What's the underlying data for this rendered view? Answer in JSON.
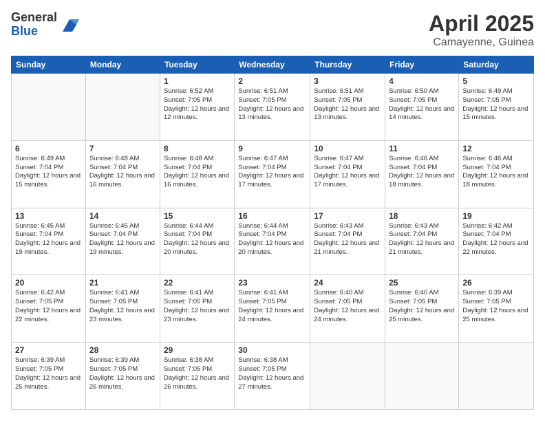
{
  "logo": {
    "general": "General",
    "blue": "Blue"
  },
  "title": {
    "month": "April 2025",
    "location": "Camayenne, Guinea"
  },
  "weekdays": [
    "Sunday",
    "Monday",
    "Tuesday",
    "Wednesday",
    "Thursday",
    "Friday",
    "Saturday"
  ],
  "weeks": [
    [
      {
        "day": "",
        "info": ""
      },
      {
        "day": "",
        "info": ""
      },
      {
        "day": "1",
        "info": "Sunrise: 6:52 AM\nSunset: 7:05 PM\nDaylight: 12 hours and 12 minutes."
      },
      {
        "day": "2",
        "info": "Sunrise: 6:51 AM\nSunset: 7:05 PM\nDaylight: 12 hours and 13 minutes."
      },
      {
        "day": "3",
        "info": "Sunrise: 6:51 AM\nSunset: 7:05 PM\nDaylight: 12 hours and 13 minutes."
      },
      {
        "day": "4",
        "info": "Sunrise: 6:50 AM\nSunset: 7:05 PM\nDaylight: 12 hours and 14 minutes."
      },
      {
        "day": "5",
        "info": "Sunrise: 6:49 AM\nSunset: 7:05 PM\nDaylight: 12 hours and 15 minutes."
      }
    ],
    [
      {
        "day": "6",
        "info": "Sunrise: 6:49 AM\nSunset: 7:04 PM\nDaylight: 12 hours and 15 minutes."
      },
      {
        "day": "7",
        "info": "Sunrise: 6:48 AM\nSunset: 7:04 PM\nDaylight: 12 hours and 16 minutes."
      },
      {
        "day": "8",
        "info": "Sunrise: 6:48 AM\nSunset: 7:04 PM\nDaylight: 12 hours and 16 minutes."
      },
      {
        "day": "9",
        "info": "Sunrise: 6:47 AM\nSunset: 7:04 PM\nDaylight: 12 hours and 17 minutes."
      },
      {
        "day": "10",
        "info": "Sunrise: 6:47 AM\nSunset: 7:04 PM\nDaylight: 12 hours and 17 minutes."
      },
      {
        "day": "11",
        "info": "Sunrise: 6:46 AM\nSunset: 7:04 PM\nDaylight: 12 hours and 18 minutes."
      },
      {
        "day": "12",
        "info": "Sunrise: 6:46 AM\nSunset: 7:04 PM\nDaylight: 12 hours and 18 minutes."
      }
    ],
    [
      {
        "day": "13",
        "info": "Sunrise: 6:45 AM\nSunset: 7:04 PM\nDaylight: 12 hours and 19 minutes."
      },
      {
        "day": "14",
        "info": "Sunrise: 6:45 AM\nSunset: 7:04 PM\nDaylight: 12 hours and 19 minutes."
      },
      {
        "day": "15",
        "info": "Sunrise: 6:44 AM\nSunset: 7:04 PM\nDaylight: 12 hours and 20 minutes."
      },
      {
        "day": "16",
        "info": "Sunrise: 6:44 AM\nSunset: 7:04 PM\nDaylight: 12 hours and 20 minutes."
      },
      {
        "day": "17",
        "info": "Sunrise: 6:43 AM\nSunset: 7:04 PM\nDaylight: 12 hours and 21 minutes."
      },
      {
        "day": "18",
        "info": "Sunrise: 6:43 AM\nSunset: 7:04 PM\nDaylight: 12 hours and 21 minutes."
      },
      {
        "day": "19",
        "info": "Sunrise: 6:42 AM\nSunset: 7:04 PM\nDaylight: 12 hours and 22 minutes."
      }
    ],
    [
      {
        "day": "20",
        "info": "Sunrise: 6:42 AM\nSunset: 7:05 PM\nDaylight: 12 hours and 22 minutes."
      },
      {
        "day": "21",
        "info": "Sunrise: 6:41 AM\nSunset: 7:05 PM\nDaylight: 12 hours and 23 minutes."
      },
      {
        "day": "22",
        "info": "Sunrise: 6:41 AM\nSunset: 7:05 PM\nDaylight: 12 hours and 23 minutes."
      },
      {
        "day": "23",
        "info": "Sunrise: 6:41 AM\nSunset: 7:05 PM\nDaylight: 12 hours and 24 minutes."
      },
      {
        "day": "24",
        "info": "Sunrise: 6:40 AM\nSunset: 7:05 PM\nDaylight: 12 hours and 24 minutes."
      },
      {
        "day": "25",
        "info": "Sunrise: 6:40 AM\nSunset: 7:05 PM\nDaylight: 12 hours and 25 minutes."
      },
      {
        "day": "26",
        "info": "Sunrise: 6:39 AM\nSunset: 7:05 PM\nDaylight: 12 hours and 25 minutes."
      }
    ],
    [
      {
        "day": "27",
        "info": "Sunrise: 6:39 AM\nSunset: 7:05 PM\nDaylight: 12 hours and 25 minutes."
      },
      {
        "day": "28",
        "info": "Sunrise: 6:39 AM\nSunset: 7:05 PM\nDaylight: 12 hours and 26 minutes."
      },
      {
        "day": "29",
        "info": "Sunrise: 6:38 AM\nSunset: 7:05 PM\nDaylight: 12 hours and 26 minutes."
      },
      {
        "day": "30",
        "info": "Sunrise: 6:38 AM\nSunset: 7:05 PM\nDaylight: 12 hours and 27 minutes."
      },
      {
        "day": "",
        "info": ""
      },
      {
        "day": "",
        "info": ""
      },
      {
        "day": "",
        "info": ""
      }
    ]
  ]
}
